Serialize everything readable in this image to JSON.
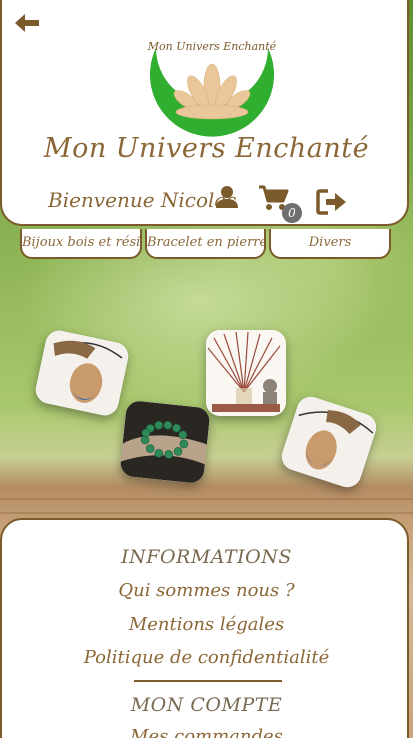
{
  "header": {
    "logo_text": "Mon Univers Enchanté",
    "site_title": "Mon Univers Enchanté",
    "welcome": "Bienvenue Nicolas",
    "cart_count": "0",
    "icons": {
      "back": "arrow-left-icon",
      "user": "user-icon",
      "cart": "cart-icon",
      "logout": "logout-icon"
    }
  },
  "categories": [
    {
      "label": "Bijoux bois et résine"
    },
    {
      "label": "Bracelet en pierre"
    },
    {
      "label": "Divers"
    }
  ],
  "products": [
    {
      "name": "pendant-wood-resin"
    },
    {
      "name": "incense-sticks"
    },
    {
      "name": "stone-bracelet"
    },
    {
      "name": "pendant-wood-resin-2"
    }
  ],
  "footer": {
    "info_heading": "INFORMATIONS",
    "links": [
      "Qui sommes nous ?",
      "Mentions légales",
      "Politique de confidentialité"
    ],
    "account_heading": "MON COMPTE",
    "account_links": [
      "Mes commandes"
    ]
  },
  "colors": {
    "brand_brown": "#8b6737",
    "border_brown": "#7b5a2b",
    "logo_green": "#2fae2f",
    "badge_gray": "#6f6f6f"
  }
}
